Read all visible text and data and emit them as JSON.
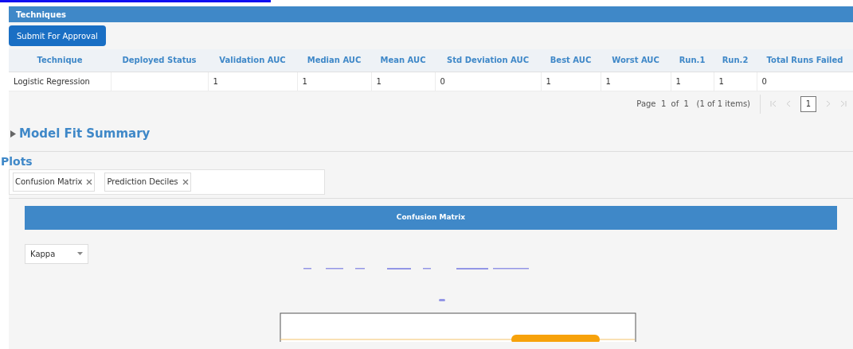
{
  "panel": {
    "title": "Techniques"
  },
  "submit_button": "Submit For Approval",
  "table": {
    "columns": [
      "Technique",
      "Deployed Status",
      "Validation AUC",
      "Median AUC",
      "Mean AUC",
      "Std Deviation AUC",
      "Best AUC",
      "Worst AUC",
      "Run.1",
      "Run.2",
      "Total Runs Failed"
    ],
    "rows": [
      [
        "Logistic Regression",
        "",
        "1",
        "1",
        "1",
        "0",
        "1",
        "1",
        "1",
        "1",
        "0"
      ]
    ]
  },
  "pager": {
    "info": "Page  1  of  1   (1 of 1 items)",
    "current_page": "1"
  },
  "model_fit_summary": {
    "title": "Model Fit Summary",
    "expanded": false
  },
  "plots": {
    "title": "Plots",
    "tags": [
      "Confusion Matrix",
      "Prediction Deciles"
    ],
    "chart_title": "Confusion Matrix",
    "dropdown": "Kappa"
  }
}
